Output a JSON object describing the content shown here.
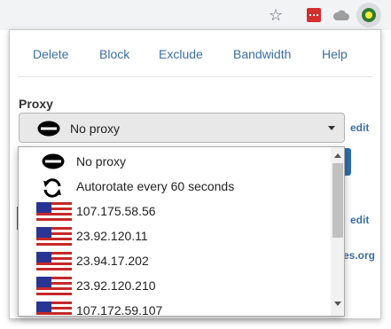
{
  "nav": {
    "delete": "Delete",
    "block": "Block",
    "exclude": "Exclude",
    "bandwidth": "Bandwidth",
    "help": "Help"
  },
  "proxy": {
    "label": "Proxy",
    "selected": "No proxy",
    "edit": "edit"
  },
  "section2": {
    "edit": "edit"
  },
  "section3": {
    "link_fragment": "es.org"
  },
  "dropdown": {
    "options": [
      {
        "label": "No proxy",
        "icon": "no-entry-icon"
      },
      {
        "label": "Autorotate every 60 seconds",
        "icon": "rotate-icon"
      },
      {
        "label": "107.175.58.56",
        "icon": "us-flag-icon"
      },
      {
        "label": "23.92.120.11",
        "icon": "us-flag-icon"
      },
      {
        "label": "23.94.17.202",
        "icon": "us-flag-icon"
      },
      {
        "label": "23.92.120.210",
        "icon": "us-flag-icon"
      },
      {
        "label": "107.172.59.107",
        "icon": "us-flag-icon"
      }
    ]
  },
  "toolbar_icons": [
    "bookmark-star-icon",
    "red-extension-icon",
    "cloud-extension-icon",
    "active-extension-icon"
  ],
  "colors": {
    "link": "#3a6ea5",
    "button": "#2c6fb0",
    "select_bg": "#e8e8e8"
  }
}
